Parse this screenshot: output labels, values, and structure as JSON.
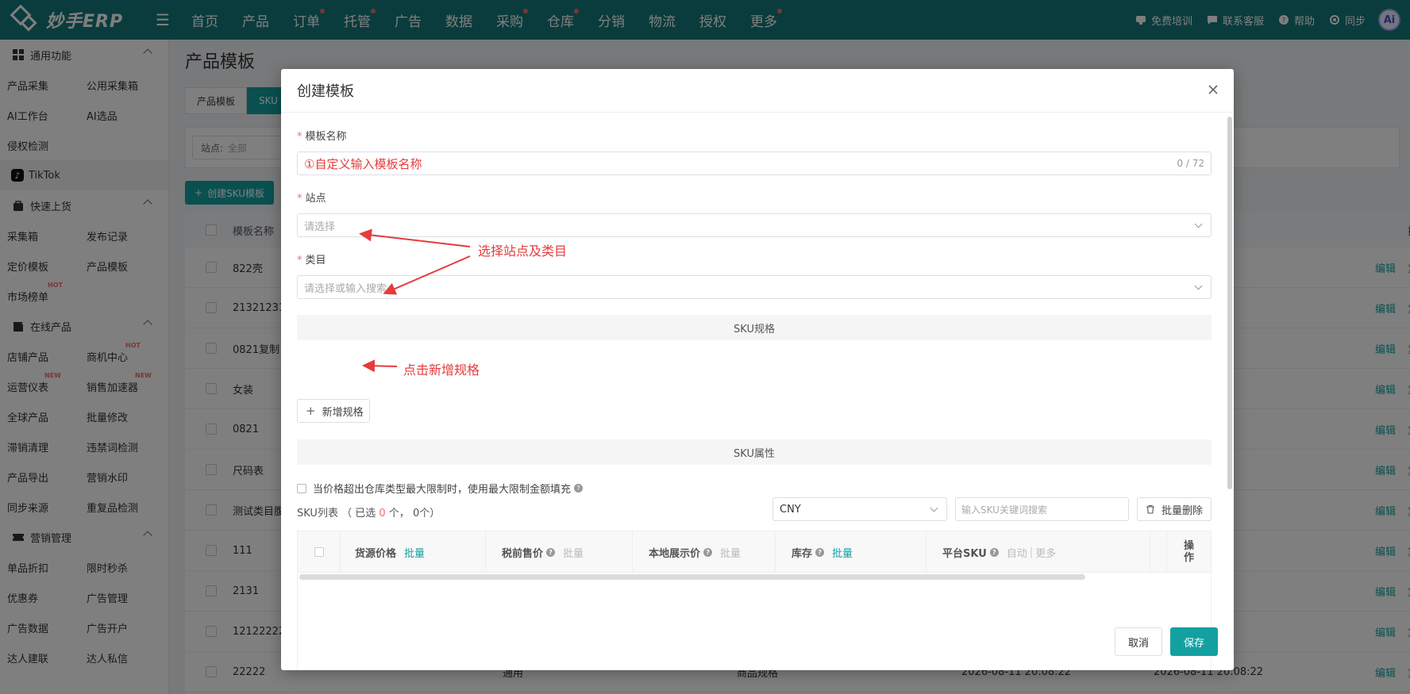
{
  "topbar": {
    "logo_text": "妙手ERP",
    "nav": [
      {
        "label": "首页",
        "dot": false
      },
      {
        "label": "产品",
        "dot": false
      },
      {
        "label": "订单",
        "dot": true
      },
      {
        "label": "托管",
        "dot": true
      },
      {
        "label": "广告",
        "dot": false
      },
      {
        "label": "数据",
        "dot": false
      },
      {
        "label": "采购",
        "dot": true
      },
      {
        "label": "仓库",
        "dot": true
      },
      {
        "label": "分销",
        "dot": false
      },
      {
        "label": "物流",
        "dot": false
      },
      {
        "label": "授权",
        "dot": false
      },
      {
        "label": "更多",
        "dot": true
      }
    ],
    "right": {
      "training": "免费培训",
      "support": "联系客服",
      "help": "帮助",
      "sync": "同步",
      "avatar": "Ai"
    }
  },
  "sidebar": {
    "group_common": "通用功能",
    "common_rows": [
      [
        "产品采集",
        "公用采集箱"
      ],
      [
        "AI工作台",
        "AI选品"
      ],
      [
        "侵权检测",
        ""
      ]
    ],
    "platform": "TikTok",
    "group_quick": "快速上货",
    "quick_rows": [
      [
        "采集箱",
        "发布记录"
      ],
      [
        "定价模板",
        "产品模板"
      ],
      [
        "市场榜单",
        ""
      ]
    ],
    "hot_tag": "HOT",
    "new_tag": "NEW",
    "group_online": "在线产品",
    "online_rows": [
      [
        "店铺产品",
        "商机中心"
      ],
      [
        "运营仪表",
        "销售加速器"
      ],
      [
        "全球产品",
        "批量修改"
      ],
      [
        "滞销清理",
        "违禁词检测"
      ],
      [
        "产品导出",
        "营销水印"
      ],
      [
        "同步来源",
        "重复品检测"
      ]
    ],
    "group_marketing": "营销管理",
    "marketing_rows": [
      [
        "单品折扣",
        "限时秒杀"
      ],
      [
        "优惠券",
        "广告管理"
      ],
      [
        "广告数据",
        "广告开户"
      ],
      [
        "达人建联",
        "达人私信"
      ]
    ]
  },
  "page": {
    "title": "产品模板",
    "tab_product": "产品模板",
    "tab_sku": "SKU",
    "filter_label": "站点:",
    "filter_value": "全部",
    "create_button": "创建SKU模板",
    "col_name": "模板名称",
    "col_op": "操",
    "rows": [
      {
        "name": "822壳",
        "r": "7"
      },
      {
        "name": "21321231",
        "r": "7"
      },
      {
        "name": "0821复制",
        "r": "2"
      },
      {
        "name": "女装",
        "r": "4"
      },
      {
        "name": "0821",
        "r": "2"
      },
      {
        "name": "尺码表",
        "r": "8"
      },
      {
        "name": "测试类目腹",
        "r": "2"
      },
      {
        "name": "111",
        "r": "2"
      },
      {
        "name": "2131",
        "r": "8"
      },
      {
        "name": "121222222",
        "r": "9"
      },
      {
        "name": "22222",
        "r": ""
      }
    ],
    "row_edit": "编辑",
    "row_copy": "复",
    "last_row_extra": [
      "通用",
      "商品规格",
      "2026-08-11 20:08:22",
      "2026-08-11 20:08:22"
    ]
  },
  "modal": {
    "title": "创建模板",
    "name_label": "模板名称",
    "name_value": "①自定义输入模板名称",
    "name_count": "0 / 72",
    "site_label": "站点",
    "site_placeholder": "请选择",
    "category_label": "类目",
    "category_placeholder": "请选择或输入搜索",
    "sku_spec_title": "SKU规格",
    "add_spec_button": "新增规格",
    "sku_attr_title": "SKU属性",
    "price_limit_text": "当价格超出仓库类型最大限制时，使用最大限制金额填充",
    "sku_list_label": "SKU列表",
    "selected_prefix": "（ 已选",
    "selected_count": "0",
    "selected_mid": "个，",
    "total_count": "0个）",
    "currency": "CNY",
    "sku_search_placeholder": "输入SKU关键词搜索",
    "batch_delete": "批量删除",
    "columns": {
      "source_price": "货源价格",
      "pre_tax_price": "税前售价",
      "local_price": "本地展示价",
      "stock": "库存",
      "platform_sku": "平台SKU",
      "batch": "批量",
      "auto": "自动",
      "more": "更多",
      "op": "操作"
    },
    "cancel": "取消",
    "save": "保存",
    "annotations": {
      "site_category": "选择站点及类目",
      "add_spec": "点击新增规格"
    }
  },
  "colors": {
    "brand": "#14787a",
    "accent": "#14a0a0",
    "annotation": "#e63b3b"
  }
}
